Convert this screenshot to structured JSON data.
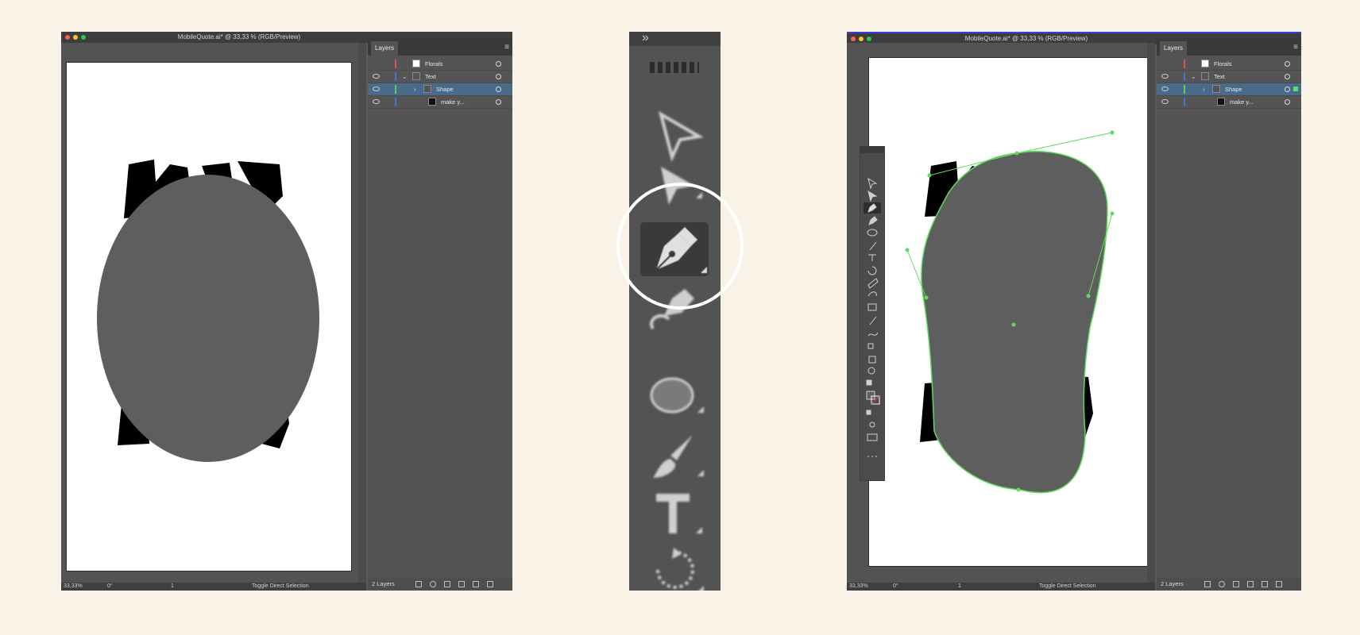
{
  "left_window": {
    "title": "MobileQuote.ai* @ 33,33 % (RGB/Preview)",
    "layers_tab": "Layers",
    "layers": [
      {
        "name": "Florals",
        "color": "#d9534f",
        "visible": false
      },
      {
        "name": "Text",
        "color": "#4a6fd6",
        "visible": true,
        "expanded": true
      },
      {
        "name": "Shape",
        "color": "#52d452",
        "visible": true,
        "selected": true
      },
      {
        "name": "make y...",
        "color": "#4a6fd6",
        "visible": true
      }
    ],
    "layers_count": "2 Layers",
    "status_zoom": "33,33%",
    "status_rotation": "0°",
    "status_page": "1",
    "status_tool": "Toggle Direct Selection"
  },
  "toolbar_zoom": {
    "header_icon": "»",
    "tools": [
      "direct-selection-tool",
      "group-selection-tool",
      "pen-tool",
      "curvature-tool",
      "ellipse-tool",
      "paintbrush-tool",
      "type-tool",
      "rotate-tool",
      "shaper-tool"
    ],
    "highlighted_tool": "pen-tool"
  },
  "right_window": {
    "title": "MobileQuote.ai* @ 33,33 % (RGB/Preview)",
    "layers_tab": "Layers",
    "layers": [
      {
        "name": "Florals",
        "color": "#d9534f",
        "visible": false
      },
      {
        "name": "Text",
        "color": "#4a6fd6",
        "visible": true,
        "expanded": true
      },
      {
        "name": "Shape",
        "color": "#52d452",
        "visible": true,
        "selected": true
      },
      {
        "name": "make y...",
        "color": "#4a6fd6",
        "visible": true
      }
    ],
    "layers_count": "2 Layers",
    "status_zoom": "33,33%",
    "status_rotation": "0°",
    "status_page": "1",
    "status_tool": "Toggle Direct Selection",
    "selection_color": "#5fdc5f"
  },
  "colors": {
    "background": "#f8f2e7",
    "shape_fill": "#5e5e5e",
    "panel": "#545454",
    "selected_row": "#4a6a8c",
    "highlight_ring": "#ffffff"
  }
}
